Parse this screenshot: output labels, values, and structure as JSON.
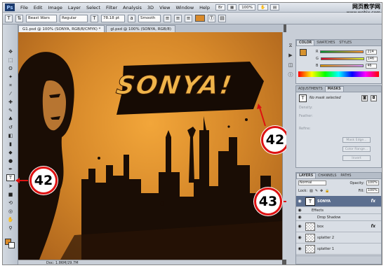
{
  "menu": [
    "File",
    "Edit",
    "Image",
    "Layer",
    "Select",
    "Filter",
    "Analysis",
    "3D",
    "View",
    "Window",
    "Help"
  ],
  "menu_right": {
    "zoom": "100%"
  },
  "watermark": {
    "line1": "网页教学网",
    "line2": "www.webjx.com"
  },
  "options": {
    "font_family": "Beast Wars",
    "font_style": "Regular",
    "font_size": "78.18 pt",
    "antialias": "Smooth",
    "text_color": "#d98a2a"
  },
  "tabs": [
    {
      "label": "G1.psd @ 100% (SONYA, RGB/8/CMYK) *"
    },
    {
      "label": "gl.psd @ 100% (SONYA, RGB/8)"
    }
  ],
  "canvas": {
    "headline": "SONYA!"
  },
  "status": {
    "doc": "Doc: 1.86M/29.7M"
  },
  "callouts": [
    "42",
    "42",
    "43"
  ],
  "color_panel": {
    "tabs": [
      "COLOR",
      "SWATCHES",
      "STYLES"
    ],
    "channels": [
      {
        "label": "R",
        "value": "214"
      },
      {
        "label": "G",
        "value": "146"
      },
      {
        "label": "B",
        "value": "46"
      }
    ]
  },
  "masks_panel": {
    "tabs": [
      "ADJUSTMENTS",
      "MASKS"
    ],
    "status": "No mask selected",
    "density": "Density:",
    "feather": "Feather:",
    "refine": "Refine:",
    "mask_edge": "Mask Edge...",
    "color_range": "Color Range...",
    "invert": "Invert"
  },
  "layers_panel": {
    "tabs": [
      "LAYERS",
      "CHANNELS",
      "PATHS"
    ],
    "blend_mode": "Normal",
    "opacity_label": "Opacity:",
    "opacity": "100%",
    "lock_label": "Lock:",
    "fill_label": "Fill:",
    "fill": "100%",
    "layers": [
      {
        "name": "SONYA",
        "fx": "fx"
      },
      {
        "name": "Effects"
      },
      {
        "name": "Drop Shadow"
      },
      {
        "name": "box",
        "fx": "fx"
      },
      {
        "name": "splatter 2"
      },
      {
        "name": "splatter 1"
      }
    ]
  }
}
